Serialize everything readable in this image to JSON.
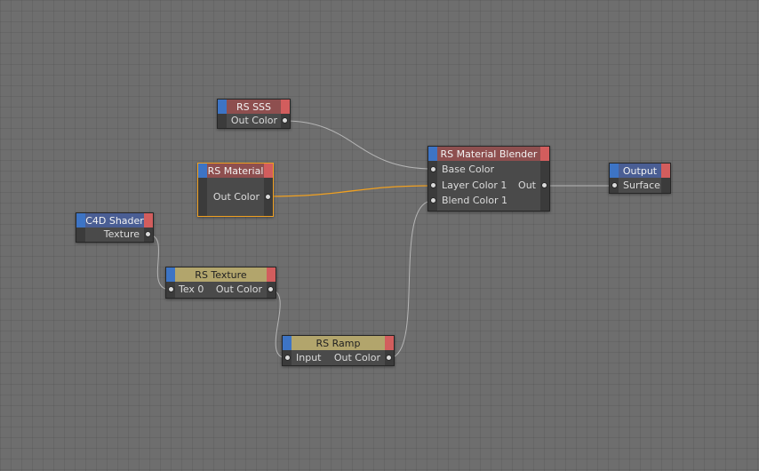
{
  "colors": {
    "canvas": "#6e6e6e",
    "node_body": "#4a4a4a",
    "header_red": "#8e4f4f",
    "header_yellow": "#b2a56c",
    "header_blue": "#4a5e94",
    "tab_blue": "#3d74c5",
    "tab_red": "#d25d5d",
    "wire": "#b5b5b5",
    "wire_selected": "#f0a020"
  },
  "nodes": {
    "rs_sss": {
      "title": "RS SSS",
      "out_label": "Out Color"
    },
    "rs_material": {
      "title": "RS Material",
      "out_label": "Out Color"
    },
    "c4d_shader": {
      "title": "C4D Shader",
      "out_label": "Texture"
    },
    "rs_texture": {
      "title": "RS Texture",
      "in_label": "Tex 0",
      "out_label": "Out Color"
    },
    "rs_ramp": {
      "title": "RS Ramp",
      "in_label": "Input",
      "out_label": "Out Color"
    },
    "material_blender": {
      "title": "RS Material Blender",
      "in_base": "Base Color",
      "in_layer": "Layer Color 1",
      "in_blend": "Blend Color 1",
      "out_label": "Out"
    },
    "output": {
      "title": "Output",
      "in_label": "Surface"
    }
  }
}
